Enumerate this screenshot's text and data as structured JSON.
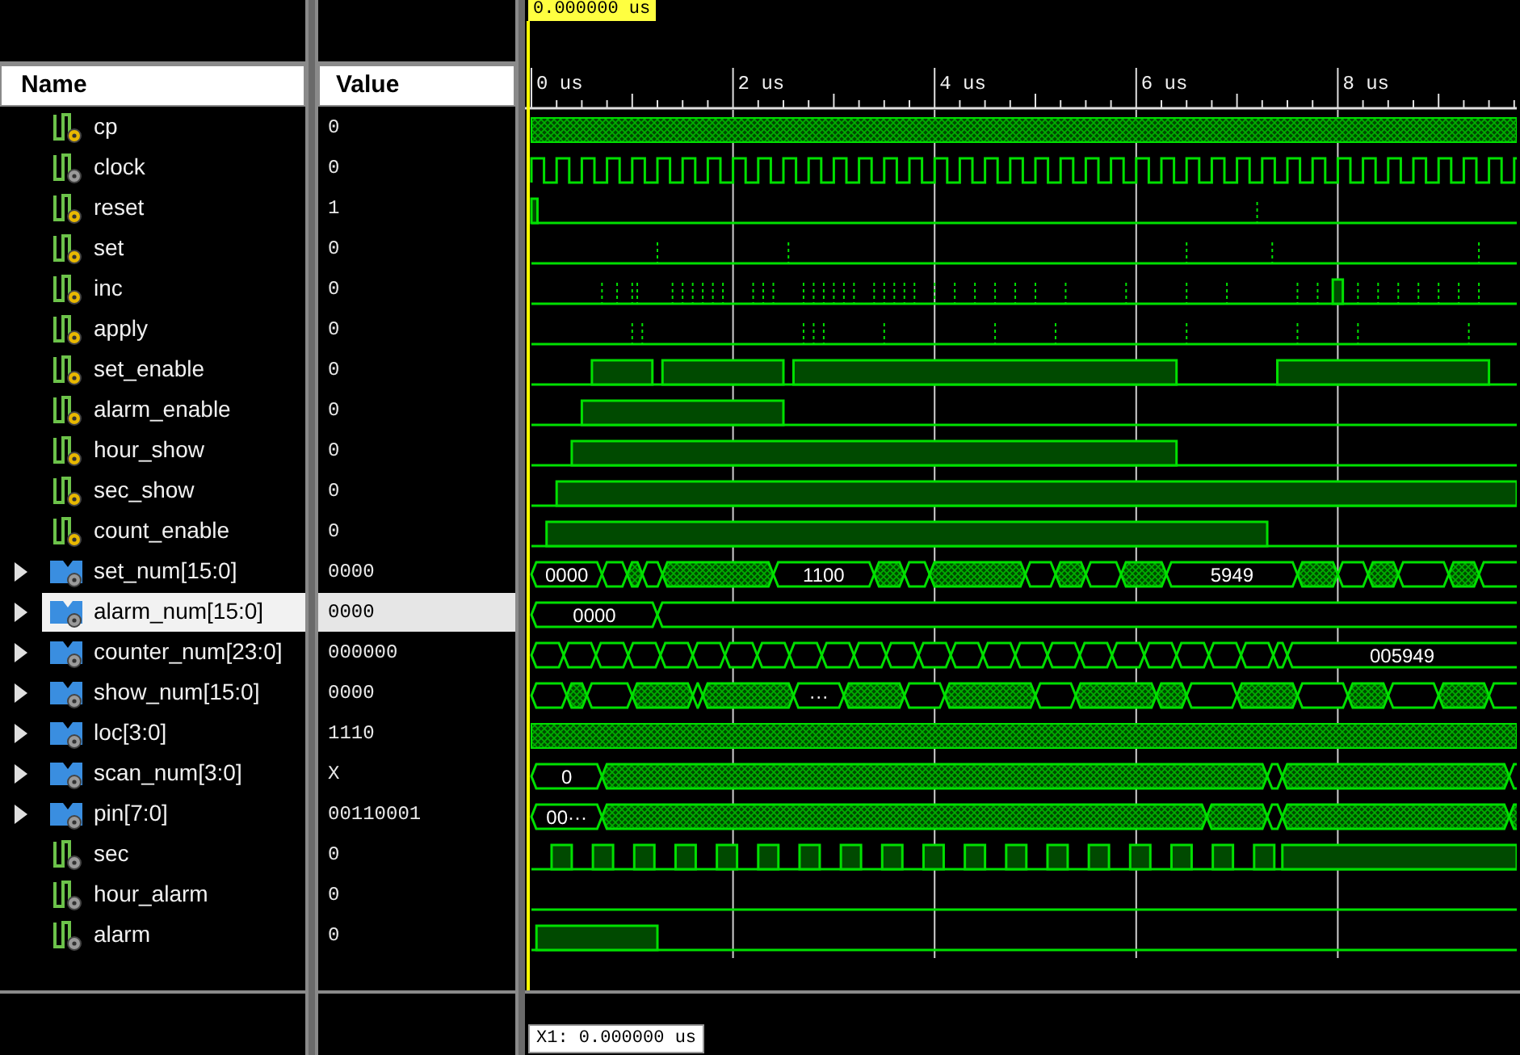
{
  "cursor": {
    "time": "0.000000 us"
  },
  "columns": {
    "name": "Name",
    "value": "Value"
  },
  "ruler": {
    "labels": [
      "0 us",
      "2 us",
      "4 us",
      "6 us",
      "8 us"
    ]
  },
  "signals": [
    {
      "name": "cp",
      "value": "0",
      "kind": "bit",
      "port": true,
      "selected": false
    },
    {
      "name": "clock",
      "value": "0",
      "kind": "bit",
      "port": false,
      "selected": false
    },
    {
      "name": "reset",
      "value": "1",
      "kind": "bit",
      "port": true,
      "selected": false
    },
    {
      "name": "set",
      "value": "0",
      "kind": "bit",
      "port": true,
      "selected": false
    },
    {
      "name": "inc",
      "value": "0",
      "kind": "bit",
      "port": true,
      "selected": false
    },
    {
      "name": "apply",
      "value": "0",
      "kind": "bit",
      "port": true,
      "selected": false
    },
    {
      "name": "set_enable",
      "value": "0",
      "kind": "bit",
      "port": true,
      "selected": false
    },
    {
      "name": "alarm_enable",
      "value": "0",
      "kind": "bit",
      "port": true,
      "selected": false
    },
    {
      "name": "hour_show",
      "value": "0",
      "kind": "bit",
      "port": true,
      "selected": false
    },
    {
      "name": "sec_show",
      "value": "0",
      "kind": "bit",
      "port": true,
      "selected": false
    },
    {
      "name": "count_enable",
      "value": "0",
      "kind": "bit",
      "port": true,
      "selected": false
    },
    {
      "name": "set_num[15:0]",
      "value": "0000",
      "kind": "bus",
      "port": false,
      "selected": false,
      "expanded": false,
      "wave_labels": [
        "0000",
        "1100",
        "5949"
      ]
    },
    {
      "name": "alarm_num[15:0]",
      "value": "0000",
      "kind": "bus",
      "port": false,
      "selected": true,
      "expanded": false,
      "wave_labels": [
        "0000"
      ]
    },
    {
      "name": "counter_num[23:0]",
      "value": "000000",
      "kind": "bus",
      "port": false,
      "selected": false,
      "expanded": false,
      "wave_labels": [
        "005949"
      ]
    },
    {
      "name": "show_num[15:0]",
      "value": "0000",
      "kind": "bus",
      "port": false,
      "selected": false,
      "expanded": false,
      "wave_labels": [
        "···"
      ]
    },
    {
      "name": "loc[3:0]",
      "value": "1110",
      "kind": "bus",
      "port": false,
      "selected": false,
      "expanded": false
    },
    {
      "name": "scan_num[3:0]",
      "value": "X",
      "kind": "bus",
      "port": false,
      "selected": false,
      "expanded": false,
      "wave_labels": [
        "0"
      ]
    },
    {
      "name": "pin[7:0]",
      "value": "00110001",
      "kind": "bus",
      "port": false,
      "selected": false,
      "expanded": false,
      "wave_labels": [
        "00···"
      ]
    },
    {
      "name": "sec",
      "value": "0",
      "kind": "bit",
      "port": false,
      "selected": false
    },
    {
      "name": "hour_alarm",
      "value": "0",
      "kind": "bit",
      "port": false,
      "selected": false
    },
    {
      "name": "alarm",
      "value": "0",
      "kind": "bit",
      "port": false,
      "selected": false
    }
  ],
  "marker": {
    "label": "X1: 0.000000 us"
  }
}
